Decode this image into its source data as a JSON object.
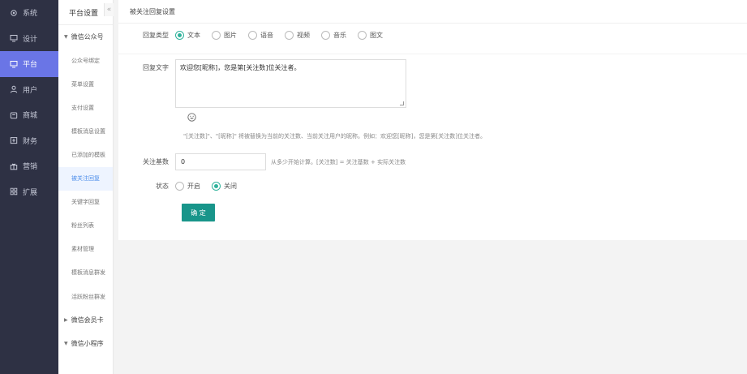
{
  "nav": {
    "items": [
      {
        "label": "系统",
        "icon": "gear-icon"
      },
      {
        "label": "设计",
        "icon": "monitor-icon"
      },
      {
        "label": "平台",
        "icon": "monitor-icon"
      },
      {
        "label": "用户",
        "icon": "user-icon"
      },
      {
        "label": "商城",
        "icon": "shop-icon"
      },
      {
        "label": "财务",
        "icon": "wallet-icon"
      },
      {
        "label": "营销",
        "icon": "gift-icon"
      },
      {
        "label": "扩展",
        "icon": "grid-icon"
      }
    ],
    "active_index": 2,
    "active_color": "#6a75e6",
    "bg_color": "#2e3144"
  },
  "submenu": {
    "header": "平台设置",
    "collapse_glyph": "«",
    "items": [
      {
        "label": "微信公众号",
        "type": "group",
        "arrow": "▼"
      },
      {
        "label": "公众号绑定",
        "type": "item"
      },
      {
        "label": "菜单设置",
        "type": "item"
      },
      {
        "label": "支付设置",
        "type": "item"
      },
      {
        "label": "模板消息设置",
        "type": "item"
      },
      {
        "label": "已添加的模板",
        "type": "item"
      },
      {
        "label": "被关注回复",
        "type": "item",
        "active": true
      },
      {
        "label": "关键字回复",
        "type": "item"
      },
      {
        "label": "粉丝列表",
        "type": "item"
      },
      {
        "label": "素材管理",
        "type": "item"
      },
      {
        "label": "模板消息群发",
        "type": "item"
      },
      {
        "label": "活跃粉丝群发",
        "type": "item"
      },
      {
        "label": "微信会员卡",
        "type": "group",
        "arrow": "▶"
      },
      {
        "label": "微信小程序",
        "type": "group",
        "arrow": "▼"
      }
    ]
  },
  "main": {
    "title": "被关注回复设置",
    "reply_type": {
      "label": "回复类型",
      "options": [
        "文本",
        "图片",
        "语音",
        "视频",
        "音乐",
        "图文"
      ],
      "selected": 0
    },
    "reply_text": {
      "label": "回复文字",
      "value": "欢迎您[昵称]，您是第[关注数]位关注者。"
    },
    "hint": "\"[关注数]\"、\"[昵称]\" 将被替换为当前的关注数、当前关注用户的昵称。例如：欢迎您[昵称]，您是第[关注数]位关注者。",
    "follow_base": {
      "label": "关注基数",
      "value": "0",
      "tip": "从多少开始计算。[关注数] = 关注基数 + 实际关注数"
    },
    "status": {
      "label": "状态",
      "options": [
        "开启",
        "关闭"
      ],
      "selected": 1
    },
    "submit_label": "确 定",
    "accent_color": "#18958a"
  }
}
